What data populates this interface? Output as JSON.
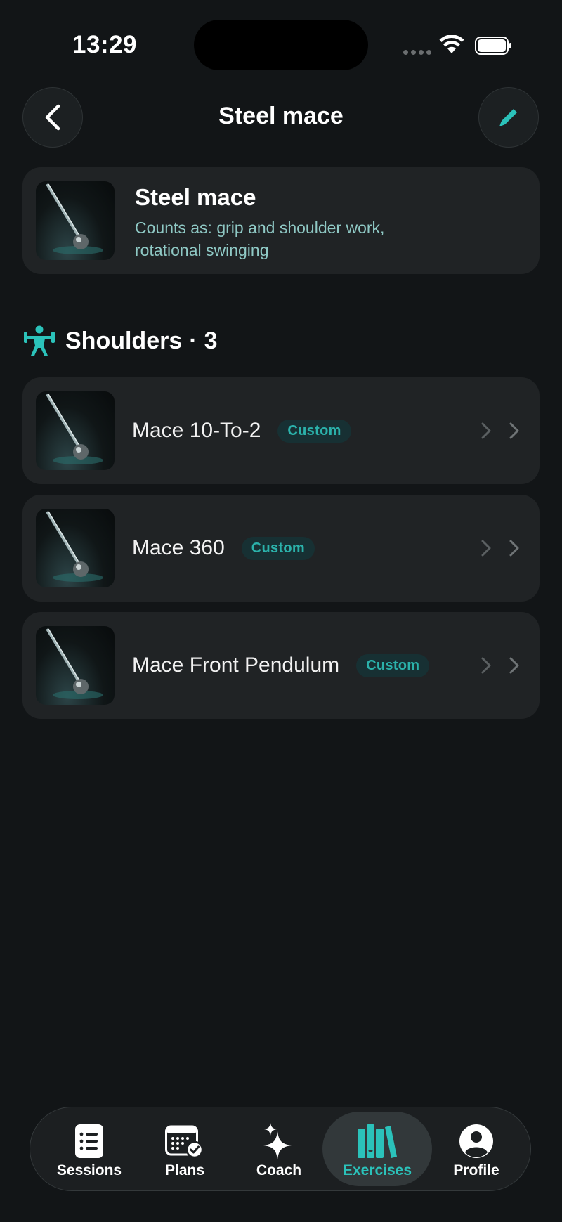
{
  "status_bar": {
    "time": "13:29"
  },
  "header": {
    "title": "Steel mace",
    "back_icon": "chevron-left-icon",
    "edit_icon": "pencil-icon"
  },
  "equipment": {
    "name": "Steel mace",
    "description": "Counts as: grip and shoulder work, rotational swinging"
  },
  "section": {
    "icon": "weightlifter-icon",
    "name": "Shoulders",
    "separator": "·",
    "count": "3"
  },
  "exercises": [
    {
      "name": "Mace 10-To-2",
      "badge": "Custom"
    },
    {
      "name": "Mace 360",
      "badge": "Custom"
    },
    {
      "name": "Mace Front Pendulum",
      "badge": "Custom"
    }
  ],
  "tabs": [
    {
      "label": "Sessions",
      "icon": "list-icon",
      "active": false
    },
    {
      "label": "Plans",
      "icon": "calendar-check-icon",
      "active": false
    },
    {
      "label": "Coach",
      "icon": "sparkles-icon",
      "active": false
    },
    {
      "label": "Exercises",
      "icon": "books-icon",
      "active": true
    },
    {
      "label": "Profile",
      "icon": "person-circle-icon",
      "active": false
    }
  ],
  "colors": {
    "accent": "#2bc2ba",
    "background": "#121517",
    "card": "#202325",
    "badge_bg": "#173033"
  }
}
